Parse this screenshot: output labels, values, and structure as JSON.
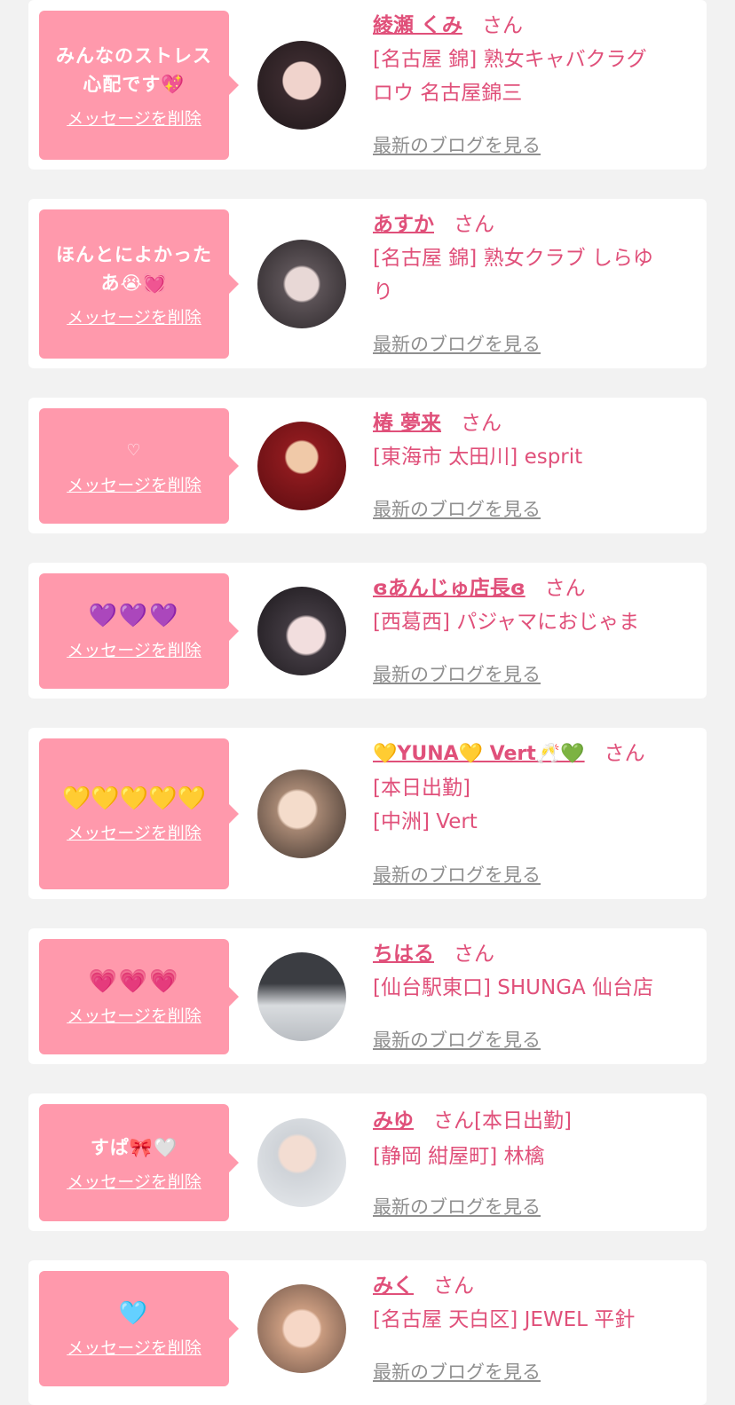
{
  "suffix": "さん",
  "delete_label": "メッセージを削除",
  "blog_label": "最新のブログを見る",
  "items": [
    {
      "message": "みんなのストレス心配です💖",
      "name": "綾瀬 くみ",
      "shop_lines": [
        "[名古屋 錦] 熟女キャバクラグ",
        "ロウ 名古屋錦三"
      ],
      "avatar_color": "#2b2126"
    },
    {
      "message": "ほんとによかったあ😭💓",
      "name": "あすか",
      "shop_lines": [
        "[名古屋 錦] 熟女クラブ しらゆ",
        "り"
      ],
      "avatar_color": "#3a3338"
    },
    {
      "message": "♡",
      "name": "椿 夢来",
      "shop_lines": [
        "[東海市 太田川] esprit"
      ],
      "avatar_color": "#7a1418"
    },
    {
      "message": "💜💜💜",
      "name": "ɞあんじゅ店長ɞ",
      "shop_lines": [
        "[西葛西] パジャマにおじゃま"
      ],
      "avatar_color": "#2f2a30"
    },
    {
      "message": "💛💛💛💛💛",
      "name": "💛YUNA💛 Vert🥂💚",
      "shop_lines": [
        "[本日出勤]",
        "[中洲] Vert"
      ],
      "avatar_color": "#b89c8a"
    },
    {
      "message": "💗💗💗",
      "name": "ちはる",
      "shop_lines": [
        "[仙台駅東口] SHUNGA 仙台店"
      ],
      "avatar_color": "#c9ccd0"
    },
    {
      "message": "すぱ🎀🤍",
      "name": "みゆ",
      "extra": "[本日出勤]",
      "shop_lines": [
        "[静岡 紺屋町] 林檎"
      ],
      "avatar_color": "#e3e6ea"
    },
    {
      "message": "🩵",
      "name": "みく",
      "shop_lines": [
        "[名古屋 天白区] JEWEL 平針"
      ],
      "avatar_color": "#d8b19a"
    }
  ]
}
